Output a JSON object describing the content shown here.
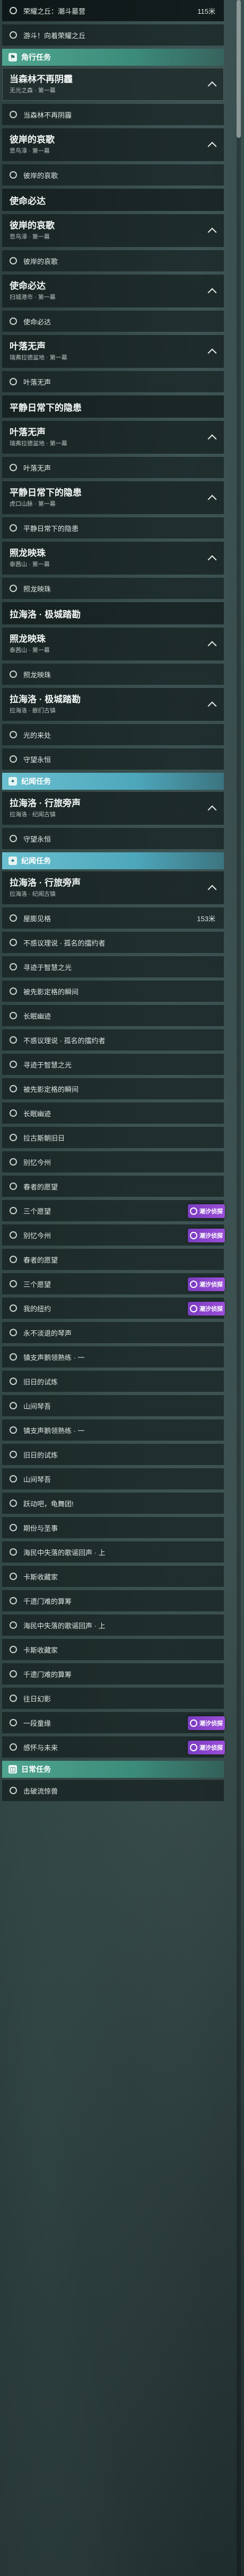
{
  "watermark": "潮汐侦探",
  "sections": [
    {
      "kind": "sub",
      "label": "荣耀之丘：潮斗墓营",
      "value": "115米",
      "dark": true
    },
    {
      "kind": "sub",
      "label": "游斗！向着荣耀之丘"
    },
    {
      "kind": "hdr",
      "style": "teal",
      "icon": "⚑",
      "label": "角行任务"
    },
    {
      "kind": "quest",
      "title": "当森林不再阴霾",
      "subtitle": "无光之森 · 第一幕",
      "selected": true
    },
    {
      "kind": "sub",
      "label": "当森林不再阴霾"
    },
    {
      "kind": "quest",
      "title": "彼岸的哀歌",
      "subtitle": "悲鸟漳 · 第一幕"
    },
    {
      "kind": "sub",
      "label": "彼岸的哀歌"
    },
    {
      "kind": "title",
      "title": "使命必达"
    },
    {
      "kind": "quest",
      "title": "彼岸的哀歌",
      "subtitle": "悲鸟漳 · 第一幕"
    },
    {
      "kind": "sub",
      "label": "彼岸的哀歌"
    },
    {
      "kind": "quest",
      "title": "使命必达",
      "subtitle": "扫城港市 · 第一幕"
    },
    {
      "kind": "sub",
      "label": "使命必达"
    },
    {
      "kind": "quest",
      "title": "叶落无声",
      "subtitle": "瑞弗拉德盆地 · 第一幕"
    },
    {
      "kind": "sub",
      "label": "叶落无声"
    },
    {
      "kind": "title",
      "title": "平静日常下的隐患"
    },
    {
      "kind": "quest",
      "title": "叶落无声",
      "subtitle": "瑞弗拉德盆地 · 第一幕"
    },
    {
      "kind": "sub",
      "label": "叶落无声"
    },
    {
      "kind": "quest",
      "title": "平静日常下的隐患",
      "subtitle": "虎口山脉 · 第一幕"
    },
    {
      "kind": "sub",
      "label": "平静日常下的隐患"
    },
    {
      "kind": "quest",
      "title": "照龙映珠",
      "subtitle": "泰茜山 · 第一幕"
    },
    {
      "kind": "sub",
      "label": "照龙映珠"
    },
    {
      "kind": "title",
      "title": "拉海洛 · 极城踏勘"
    },
    {
      "kind": "quest",
      "title": "照龙映珠",
      "subtitle": "泰茜山 · 第一幕"
    },
    {
      "kind": "sub",
      "label": "照龙映珠"
    },
    {
      "kind": "quest",
      "title": "拉海洛 · 极城踏勘",
      "subtitle": "拉海洛 · 嵌们古镇"
    },
    {
      "kind": "sub",
      "label": "光的来处"
    },
    {
      "kind": "sub",
      "label": "守望永恒"
    },
    {
      "kind": "hdr",
      "style": "cyan",
      "icon": "✦",
      "label": "纪闻任务"
    },
    {
      "kind": "quest",
      "title": "拉海洛 · 行旅旁声",
      "subtitle": "拉海洛 · 纪闻古镇"
    },
    {
      "kind": "sub",
      "label": "守望永恒"
    },
    {
      "kind": "hdr",
      "style": "cyan",
      "icon": "✦",
      "label": "纪闻任务"
    },
    {
      "kind": "quest",
      "title": "拉海洛 · 行旅旁声",
      "subtitle": "拉海洛 · 纪闻古镇"
    },
    {
      "kind": "sub",
      "label": "屋膨见格",
      "value": "153米"
    },
    {
      "kind": "sub",
      "label": "不惑议理说 · 孤名的擂约者"
    },
    {
      "kind": "sub",
      "label": "寻迹于智慧之光"
    },
    {
      "kind": "sub",
      "label": "被先影定格的瞬间"
    },
    {
      "kind": "sub",
      "label": "长眠幽迹"
    },
    {
      "kind": "sub",
      "label": "不惑议理说 · 孤名的擂约者"
    },
    {
      "kind": "sub",
      "label": "寻迹于智慧之光"
    },
    {
      "kind": "sub",
      "label": "被先影定格的瞬间"
    },
    {
      "kind": "sub",
      "label": "长眠幽迹"
    },
    {
      "kind": "sub",
      "label": "拉古斯朝旧日"
    },
    {
      "kind": "sub",
      "label": "别忆今州"
    },
    {
      "kind": "sub",
      "label": "春者的愿望"
    },
    {
      "kind": "sub",
      "label": "三个愿望",
      "badge": true
    },
    {
      "kind": "sub",
      "label": "别忆今州",
      "badge": true
    },
    {
      "kind": "sub",
      "label": "春者的愿望"
    },
    {
      "kind": "sub",
      "label": "三个愿望",
      "badge": true
    },
    {
      "kind": "sub",
      "label": "我的纽约",
      "badge": true
    },
    {
      "kind": "sub",
      "label": "永不淡退的琴声"
    },
    {
      "kind": "sub",
      "label": "镇支声鹅领熟练 · 一"
    },
    {
      "kind": "sub",
      "label": "旧日的试炼"
    },
    {
      "kind": "sub",
      "label": "山间琴吾"
    },
    {
      "kind": "sub",
      "label": "镇支声鹅领熟练 · 一"
    },
    {
      "kind": "sub",
      "label": "旧日的试炼"
    },
    {
      "kind": "sub",
      "label": "山间琴吾"
    },
    {
      "kind": "sub",
      "label": "跃动吧，龟舞团!"
    },
    {
      "kind": "sub",
      "label": "期份与圣事"
    },
    {
      "kind": "sub",
      "label": "海民中失落的歌谣回声 · 上"
    },
    {
      "kind": "sub",
      "label": "卡斯收藏家"
    },
    {
      "kind": "sub",
      "label": "千遗门难的算筹"
    },
    {
      "kind": "sub",
      "label": "海民中失落的歌谣回声 · 上"
    },
    {
      "kind": "sub",
      "label": "卡斯收藏家"
    },
    {
      "kind": "sub",
      "label": "千遗门难的算筹"
    },
    {
      "kind": "sub",
      "label": "往日幻影"
    },
    {
      "kind": "sub",
      "label": "一段童缘",
      "badge": true
    },
    {
      "kind": "sub",
      "label": "感怀与未来",
      "badge": true
    },
    {
      "kind": "hdr",
      "style": "teal",
      "icon": "◫",
      "label": "日常任务"
    },
    {
      "kind": "sub",
      "label": "击破流惊兽"
    }
  ]
}
